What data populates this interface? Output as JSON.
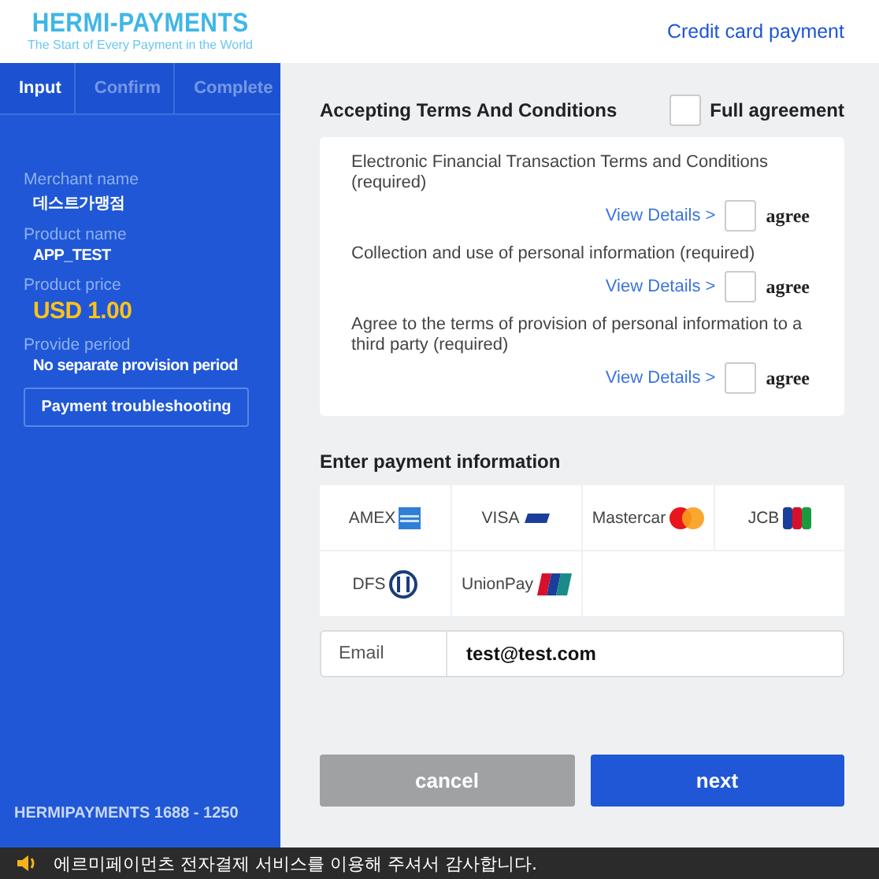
{
  "header": {
    "logo": "HERMI-PAYMENTS",
    "tagline": "The Start of Every Payment in the  World",
    "title": "Credit card payment"
  },
  "steps": [
    {
      "label": "Input",
      "selected": true
    },
    {
      "label": "Confirm",
      "selected": false
    },
    {
      "label": "Complete",
      "selected": false
    }
  ],
  "order": [
    {
      "label": "Merchant name",
      "value": "데스트가맹점",
      "kind": "plain"
    },
    {
      "label": "Product name",
      "value": "APP_TEST",
      "kind": "plain"
    },
    {
      "label": "Product price",
      "value": "USD 1.00",
      "kind": "price"
    },
    {
      "label": "Provide period",
      "value": "No separate provision period",
      "kind": "plain"
    }
  ],
  "troubleshoot_button": "Payment troubleshooting",
  "phone": "HERMIPAYMENTS 1688 - 1250",
  "terms": {
    "title": "Accepting Terms And Conditions",
    "full_agreement": {
      "label": "Full agreement",
      "checked": false
    },
    "items": [
      {
        "text": "Electronic Financial Transaction Terms and Conditions (required)",
        "link": "View Details >",
        "agree": "agree",
        "checked": false
      },
      {
        "text": "Collection and use of personal information (required)",
        "link": "View Details >",
        "agree": "agree",
        "checked": false
      },
      {
        "text": "Agree to the terms of provision of personal information to a third party (required)",
        "link": "View Details >",
        "agree": "agree",
        "checked": false
      }
    ]
  },
  "payment": {
    "title": "Enter payment information",
    "cards": [
      {
        "name": "AMEX",
        "kind": "amex"
      },
      {
        "name": "VISA",
        "kind": "visa"
      },
      {
        "name": "Mastercar",
        "kind": "mastercard"
      },
      {
        "name": "JCB",
        "kind": "jcb"
      },
      {
        "name": "DFS",
        "kind": "dfs"
      },
      {
        "name": "UnionPay",
        "kind": "unionpay"
      }
    ],
    "email": {
      "label": "Email",
      "value": "test@test.com"
    }
  },
  "buttons": {
    "cancel": "cancel",
    "next": "next"
  },
  "notice": "에르미페이먼츠 전자결제 서비스를 이용해 주셔서 감사합니다."
}
